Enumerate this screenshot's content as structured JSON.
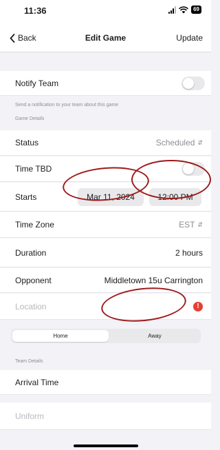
{
  "status_bar": {
    "time": "11:36",
    "battery": "69"
  },
  "nav": {
    "back_label": "Back",
    "title": "Edit Game",
    "action_label": "Update"
  },
  "notify": {
    "label": "Notify Team",
    "enabled": false,
    "caption": "Send a notification to your team about this game"
  },
  "sections": {
    "game_details": "Game Details",
    "team_details": "Team Details"
  },
  "fields": {
    "status": {
      "label": "Status",
      "value": "Scheduled"
    },
    "time_tbd": {
      "label": "Time TBD",
      "enabled": false
    },
    "starts": {
      "label": "Starts",
      "date": "Mar 11, 2024",
      "time": "12:00 PM"
    },
    "time_zone": {
      "label": "Time Zone",
      "value": "EST"
    },
    "duration": {
      "label": "Duration",
      "value": "2 hours"
    },
    "opponent": {
      "label": "Opponent",
      "value": "Middletown 15u Carrington"
    },
    "location": {
      "placeholder": "Location"
    },
    "arrival_time": {
      "label": "Arrival Time"
    },
    "uniform": {
      "placeholder": "Uniform"
    }
  },
  "home_away": {
    "options": [
      "Home",
      "Away"
    ],
    "selected": "Home"
  },
  "colors": {
    "accent_red": "#e64034",
    "annotation": "#9e1a1a"
  }
}
